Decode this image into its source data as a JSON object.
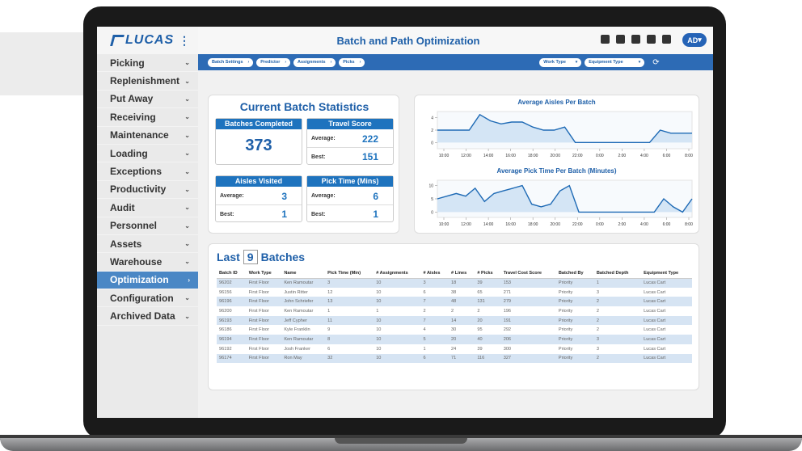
{
  "app": {
    "logo_text": "LUCAS",
    "title": "Batch and Path Optimization",
    "user_initials": "AD"
  },
  "sidebar": {
    "items": [
      {
        "label": "Picking",
        "active": false
      },
      {
        "label": "Replenishment",
        "active": false
      },
      {
        "label": "Put Away",
        "active": false
      },
      {
        "label": "Receiving",
        "active": false
      },
      {
        "label": "Maintenance",
        "active": false
      },
      {
        "label": "Loading",
        "active": false
      },
      {
        "label": "Exceptions",
        "active": false
      },
      {
        "label": "Productivity",
        "active": false
      },
      {
        "label": "Audit",
        "active": false
      },
      {
        "label": "Personnel",
        "active": false
      },
      {
        "label": "Assets",
        "active": false
      },
      {
        "label": "Warehouse",
        "active": false
      },
      {
        "label": "Optimization",
        "active": true
      },
      {
        "label": "Configuration",
        "active": false
      },
      {
        "label": "Archived Data",
        "active": false
      }
    ]
  },
  "filters": {
    "crumbs": [
      "Batch Settings",
      "Predictor",
      "Assignments",
      "Picks"
    ],
    "work_type": "Work Type",
    "equipment_type": "Equipment Type"
  },
  "stats": {
    "title": "Current Batch Statistics",
    "batches_completed": {
      "label": "Batches Completed",
      "value": "373"
    },
    "travel_score": {
      "label": "Travel Score",
      "average_label": "Average:",
      "average": "222",
      "best_label": "Best:",
      "best": "151"
    },
    "aisles_visited": {
      "label": "Aisles Visited",
      "average_label": "Average:",
      "average": "3",
      "best_label": "Best:",
      "best": "1"
    },
    "pick_time": {
      "label": "Pick Time (Mins)",
      "average_label": "Average:",
      "average": "6",
      "best_label": "Best:",
      "best": "1"
    }
  },
  "chart_data": [
    {
      "type": "area",
      "title": "Average Aisles Per Batch",
      "x": [
        "10:00",
        "12:00",
        "14:00",
        "16:00",
        "18:00",
        "20:00",
        "22:00",
        "0:00",
        "2:00",
        "4:00",
        "6:00",
        "8:00"
      ],
      "y_ticks": [
        "4",
        "2",
        "0"
      ],
      "ylim": [
        -1,
        5
      ],
      "values": [
        2,
        2,
        2,
        2,
        4.5,
        3.5,
        3,
        3.3,
        3.3,
        2.5,
        2,
        2,
        2.5,
        0,
        0,
        0,
        0,
        0,
        0,
        0,
        0,
        2,
        1.5,
        1.5,
        1.5
      ],
      "color": "#1e6ab5"
    },
    {
      "type": "area",
      "title": "Average Pick Time Per Batch (Minutes)",
      "x": [
        "10:00",
        "12:00",
        "14:00",
        "16:00",
        "18:00",
        "20:00",
        "22:00",
        "0:00",
        "2:00",
        "4:00",
        "6:00",
        "8:00"
      ],
      "y_ticks": [
        "10",
        "5",
        "0"
      ],
      "ylim": [
        -2,
        12
      ],
      "values": [
        5,
        6,
        7,
        6,
        9,
        4,
        7,
        8,
        9,
        10,
        3,
        2,
        3,
        8,
        10,
        0,
        0,
        0,
        0,
        0,
        0,
        0,
        0,
        0,
        5,
        2,
        0,
        5
      ],
      "color": "#1e6ab5"
    }
  ],
  "batches": {
    "title_prefix": "Last",
    "count": "9",
    "title_suffix": "Batches",
    "columns": [
      "Batch ID",
      "Work Type",
      "Name",
      "Pick Time (Min)",
      "# Assignments",
      "# Aisles",
      "# Lines",
      "# Picks",
      "Travel Cost Score",
      "Batched By",
      "Batched Depth",
      "Equipment Type"
    ],
    "rows": [
      [
        "96202",
        "First Floor",
        "Ken Ramoutar",
        "3",
        "10",
        "3",
        "18",
        "39",
        "153",
        "Priority",
        "1",
        "Lucas Cart"
      ],
      [
        "96156",
        "First Floor",
        "Justin Ritter",
        "12",
        "10",
        "6",
        "38",
        "65",
        "271",
        "Priority",
        "3",
        "Lucas Cart"
      ],
      [
        "96196",
        "First Floor",
        "John Schriefer",
        "13",
        "10",
        "7",
        "48",
        "131",
        "279",
        "Priority",
        "2",
        "Lucas Cart"
      ],
      [
        "96200",
        "First Floor",
        "Ken Ramoutar",
        "1",
        "1",
        "2",
        "2",
        "2",
        "196",
        "Priority",
        "2",
        "Lucas Cart"
      ],
      [
        "96193",
        "First Floor",
        "Jeff Cypher",
        "11",
        "10",
        "7",
        "14",
        "20",
        "191",
        "Priority",
        "2",
        "Lucas Cart"
      ],
      [
        "96186",
        "First Floor",
        "Kyle Franklin",
        "9",
        "10",
        "4",
        "30",
        "95",
        "292",
        "Priority",
        "2",
        "Lucas Cart"
      ],
      [
        "96194",
        "First Floor",
        "Ken Ramoutar",
        "8",
        "10",
        "5",
        "20",
        "40",
        "206",
        "Priority",
        "3",
        "Lucas Cart"
      ],
      [
        "96192",
        "First Floor",
        "Josh Franker",
        "6",
        "10",
        "1",
        "24",
        "39",
        "300",
        "Priority",
        "3",
        "Lucas Cart"
      ],
      [
        "96174",
        "First Floor",
        "Ron May",
        "32",
        "10",
        "6",
        "71",
        "116",
        "327",
        "Priority",
        "2",
        "Lucas Cart"
      ]
    ]
  }
}
